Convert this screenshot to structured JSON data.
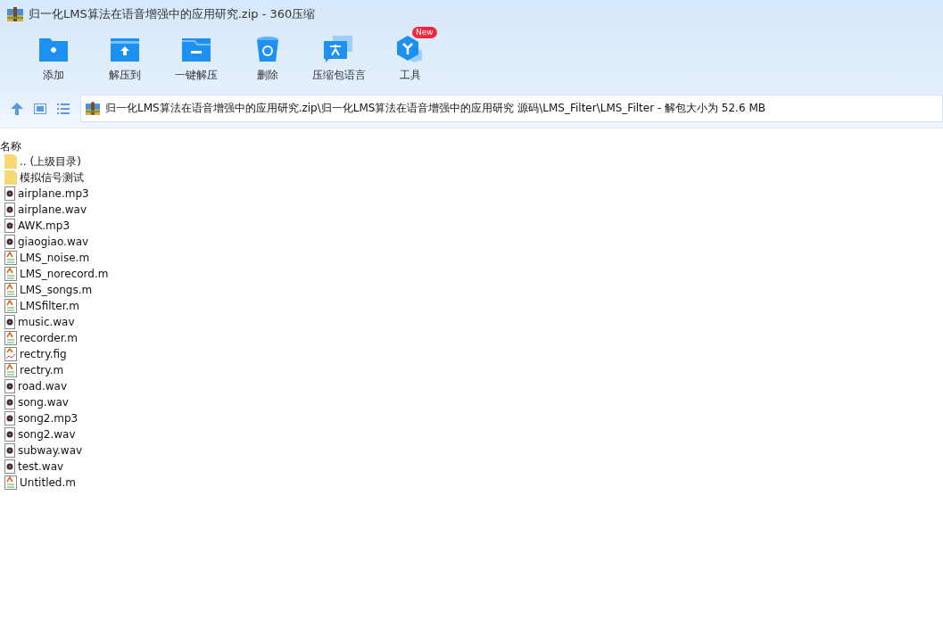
{
  "window": {
    "title": "归一化LMS算法在语音增强中的应用研究.zip - 360压缩"
  },
  "toolbar": [
    {
      "label": "添加",
      "kind": "add"
    },
    {
      "label": "解压到",
      "kind": "extract"
    },
    {
      "label": "一键解压",
      "kind": "oneclick"
    },
    {
      "label": "删除",
      "kind": "delete"
    },
    {
      "label": "压缩包语言",
      "kind": "language"
    },
    {
      "label": "工具",
      "kind": "tools",
      "badge": "New"
    }
  ],
  "address": {
    "path": "归一化LMS算法在语音增强中的应用研究.zip\\归一化LMS算法在语音增强中的应用研究 源码\\LMS_Filter\\LMS_Filter - 解包大小为 52.6 MB"
  },
  "table": {
    "columns": [
      "名称"
    ],
    "rows": [
      {
        "name": ".. (上级目录)",
        "kind": "folder"
      },
      {
        "name": "模拟信号测试",
        "kind": "folder"
      },
      {
        "name": "airplane.mp3",
        "kind": "audio"
      },
      {
        "name": "airplane.wav",
        "kind": "audio"
      },
      {
        "name": "AWK.mp3",
        "kind": "audio"
      },
      {
        "name": "giaogiao.wav",
        "kind": "audio"
      },
      {
        "name": "LMS_noise.m",
        "kind": "script"
      },
      {
        "name": "LMS_norecord.m",
        "kind": "script"
      },
      {
        "name": "LMS_songs.m",
        "kind": "script"
      },
      {
        "name": "LMSfilter.m",
        "kind": "script"
      },
      {
        "name": "music.wav",
        "kind": "audio"
      },
      {
        "name": "recorder.m",
        "kind": "script"
      },
      {
        "name": "rectry.fig",
        "kind": "figure"
      },
      {
        "name": "rectry.m",
        "kind": "script"
      },
      {
        "name": "road.wav",
        "kind": "audio"
      },
      {
        "name": "song.wav",
        "kind": "audio"
      },
      {
        "name": "song2.mp3",
        "kind": "audio"
      },
      {
        "name": "song2.wav",
        "kind": "audio"
      },
      {
        "name": "subway.wav",
        "kind": "audio"
      },
      {
        "name": "test.wav",
        "kind": "audio"
      },
      {
        "name": "Untitled.m",
        "kind": "script"
      }
    ]
  }
}
